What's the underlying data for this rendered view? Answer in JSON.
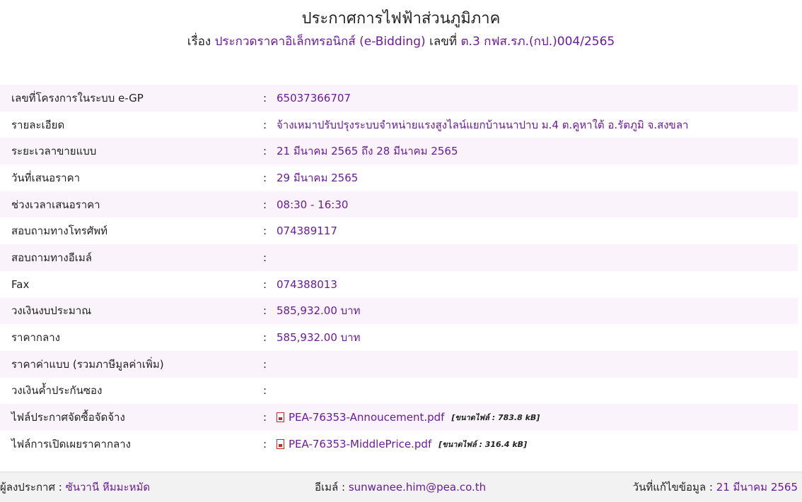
{
  "header": {
    "title": "ประกาศการไฟฟ้าส่วนภูมิภาค",
    "subject_label": "เรื่อง",
    "subject": "ประกวดราคาอิเล็กทรอนิกส์ (e-Bidding)",
    "number_label": "เลขที่",
    "number": "ต.3 กฟส.รภ.(กป.)004/2565"
  },
  "separator": ":",
  "details": [
    {
      "label": "เลขที่โครงการในระบบ e-GP",
      "value": "65037366707"
    },
    {
      "label": "รายละเอียด",
      "value": "จ้างเหมาปรับปรุงระบบจำหน่ายแรงสูงไลน์แยกบ้านนาปาบ ม.4 ต.คูหาใต้ อ.รัตภูมิ จ.สงขลา"
    },
    {
      "label": "ระยะเวลาขายแบบ",
      "value": "21 มีนาคม 2565 ถึง 28 มีนาคม 2565"
    },
    {
      "label": "วันที่เสนอราคา",
      "value": "29 มีนาคม 2565"
    },
    {
      "label": "ช่วงเวลาเสนอราคา",
      "value": "08:30 - 16:30"
    },
    {
      "label": "สอบถามทางโทรศัพท์",
      "value": "074389117"
    },
    {
      "label": "สอบถามทางอีเมล์",
      "value": ""
    },
    {
      "label": "Fax",
      "value": "074388013"
    },
    {
      "label": "วงเงินงบประมาณ",
      "value": "585,932.00 บาท"
    },
    {
      "label": "ราคากลาง",
      "value": "585,932.00 บาท"
    },
    {
      "label": "ราคาค่าแบบ (รวมภาษีมูลค่าเพิ่ม)",
      "value": ""
    },
    {
      "label": "วงเงินค้ำประกันซอง",
      "value": ""
    }
  ],
  "files": [
    {
      "label": "ไฟล์ประกาศจัดซื้อจัดจ้าง",
      "filename": "PEA-76353-Annoucement.pdf",
      "size": "[ขนาดไฟล์ : 783.8 kB]",
      "icon": "pdf-file-icon"
    },
    {
      "label": "ไฟล์การเปิดเผยราคากลาง",
      "filename": "PEA-76353-MiddlePrice.pdf",
      "size": "[ขนาดไฟล์ : 316.4 kB]",
      "icon": "pdf-file-icon"
    }
  ],
  "footer": {
    "announcer_label": "ผู้ลงประกาศ :",
    "announcer": "ซันวานี หีมมะหมัด",
    "email_label": "อีเมล์ :",
    "email": "sunwanee.him@pea.co.th",
    "updated_label": "วันที่แก้ไขข้อมูล :",
    "updated": "21 มีนาคม 2565"
  },
  "colors": {
    "accent": "#6a1b9a",
    "row_shade": "#faf3fb",
    "footer_bg": "#f2f2f2",
    "pdf_icon": "#c62828"
  }
}
